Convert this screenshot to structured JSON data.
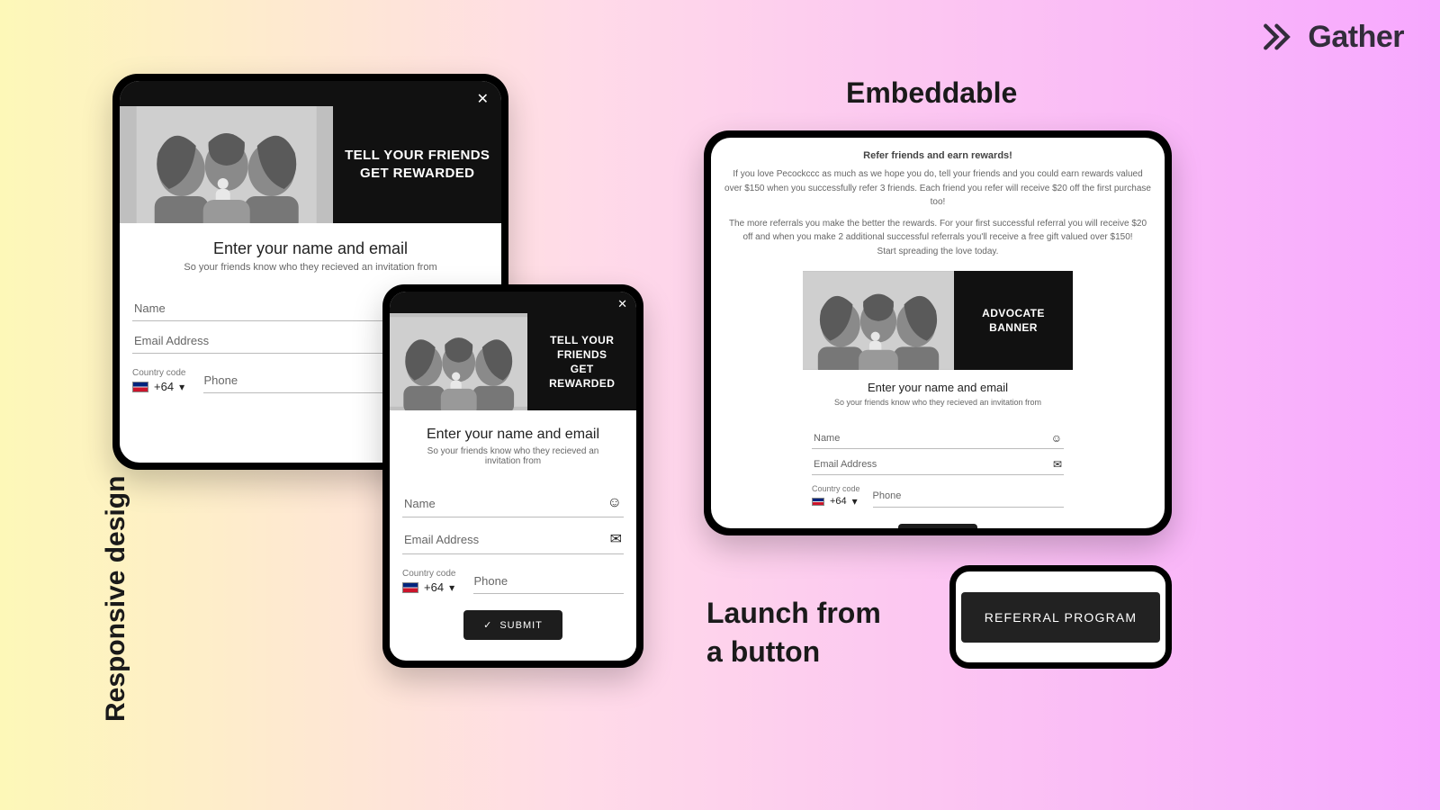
{
  "brand": {
    "name": "Gather"
  },
  "labels": {
    "responsive": "Responsive design",
    "embeddable": "Embeddable",
    "launch_line1": "Launch from",
    "launch_line2": "a button"
  },
  "hero": {
    "line1": "TELL YOUR FRIENDS",
    "line2": "GET REWARDED",
    "advocate": "ADVOCATE BANNER"
  },
  "form": {
    "title": "Enter your name and email",
    "subtitle": "So your friends know who they recieved an invitation from",
    "name_ph": "Name",
    "email_ph": "Email Address",
    "cc_label": "Country code",
    "cc_value": "+64",
    "phone_ph": "Phone",
    "submit": "SUBMIT"
  },
  "embed": {
    "title": "Refer friends and earn rewards!",
    "p1": "If you love Pecockccc  as much as we hope you do, tell your friends and you could earn rewards valued over $150 when you successfully refer 3 friends.  Each friend you refer will receive $20 off the first purchase too!",
    "p2": "The more referrals you make the better the rewards. For your first successful referral you will receive $20 off and when you make 2 additional successful referrals you'll receive a free gift valued over $150!",
    "p3": "Start spreading the love today."
  },
  "launch_button": "REFERRAL PROGRAM"
}
